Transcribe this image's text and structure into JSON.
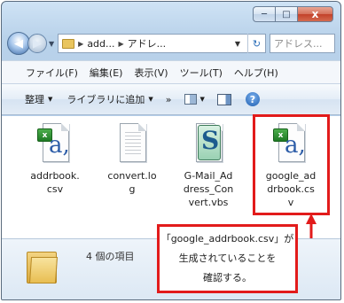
{
  "window": {
    "caption_buttons": {
      "minimize": "─",
      "maximize": "□",
      "close": "x"
    }
  },
  "address_bar": {
    "back_glyph": "◀",
    "crumbs": [
      "add...",
      "アドレ..."
    ],
    "search_placeholder": "アドレス..."
  },
  "menubar": {
    "items": [
      "ファイル(F)",
      "編集(E)",
      "表示(V)",
      "ツール(T)",
      "ヘルプ(H)"
    ]
  },
  "commandbar": {
    "organize": "整理",
    "add_to_library": "ライブラリに追加",
    "more": "»",
    "help": "?"
  },
  "files": [
    {
      "name": "addrbook.csv",
      "label_lines": [
        "addrbook.",
        "csv"
      ],
      "icon": "excel-csv-icon"
    },
    {
      "name": "convert.log",
      "label_lines": [
        "convert.lo",
        "g"
      ],
      "icon": "text-document-icon"
    },
    {
      "name": "G-Mail_Address_Convert.vbs",
      "label_lines": [
        "G-Mail_Ad",
        "dress_Con",
        "vert.vbs"
      ],
      "icon": "vbs-script-icon"
    },
    {
      "name": "google_addrbook.csv",
      "label_lines": [
        "google_ad",
        "drbook.cs",
        "v"
      ],
      "icon": "excel-csv-icon"
    }
  ],
  "status": {
    "item_count": "4 個の項目"
  },
  "callout": {
    "lines": [
      "「google_addrbook.csv」が",
      "生成されていることを",
      "確認する。"
    ]
  },
  "colors": {
    "highlight": "#e21b1b",
    "accent": "#2d5da8"
  }
}
